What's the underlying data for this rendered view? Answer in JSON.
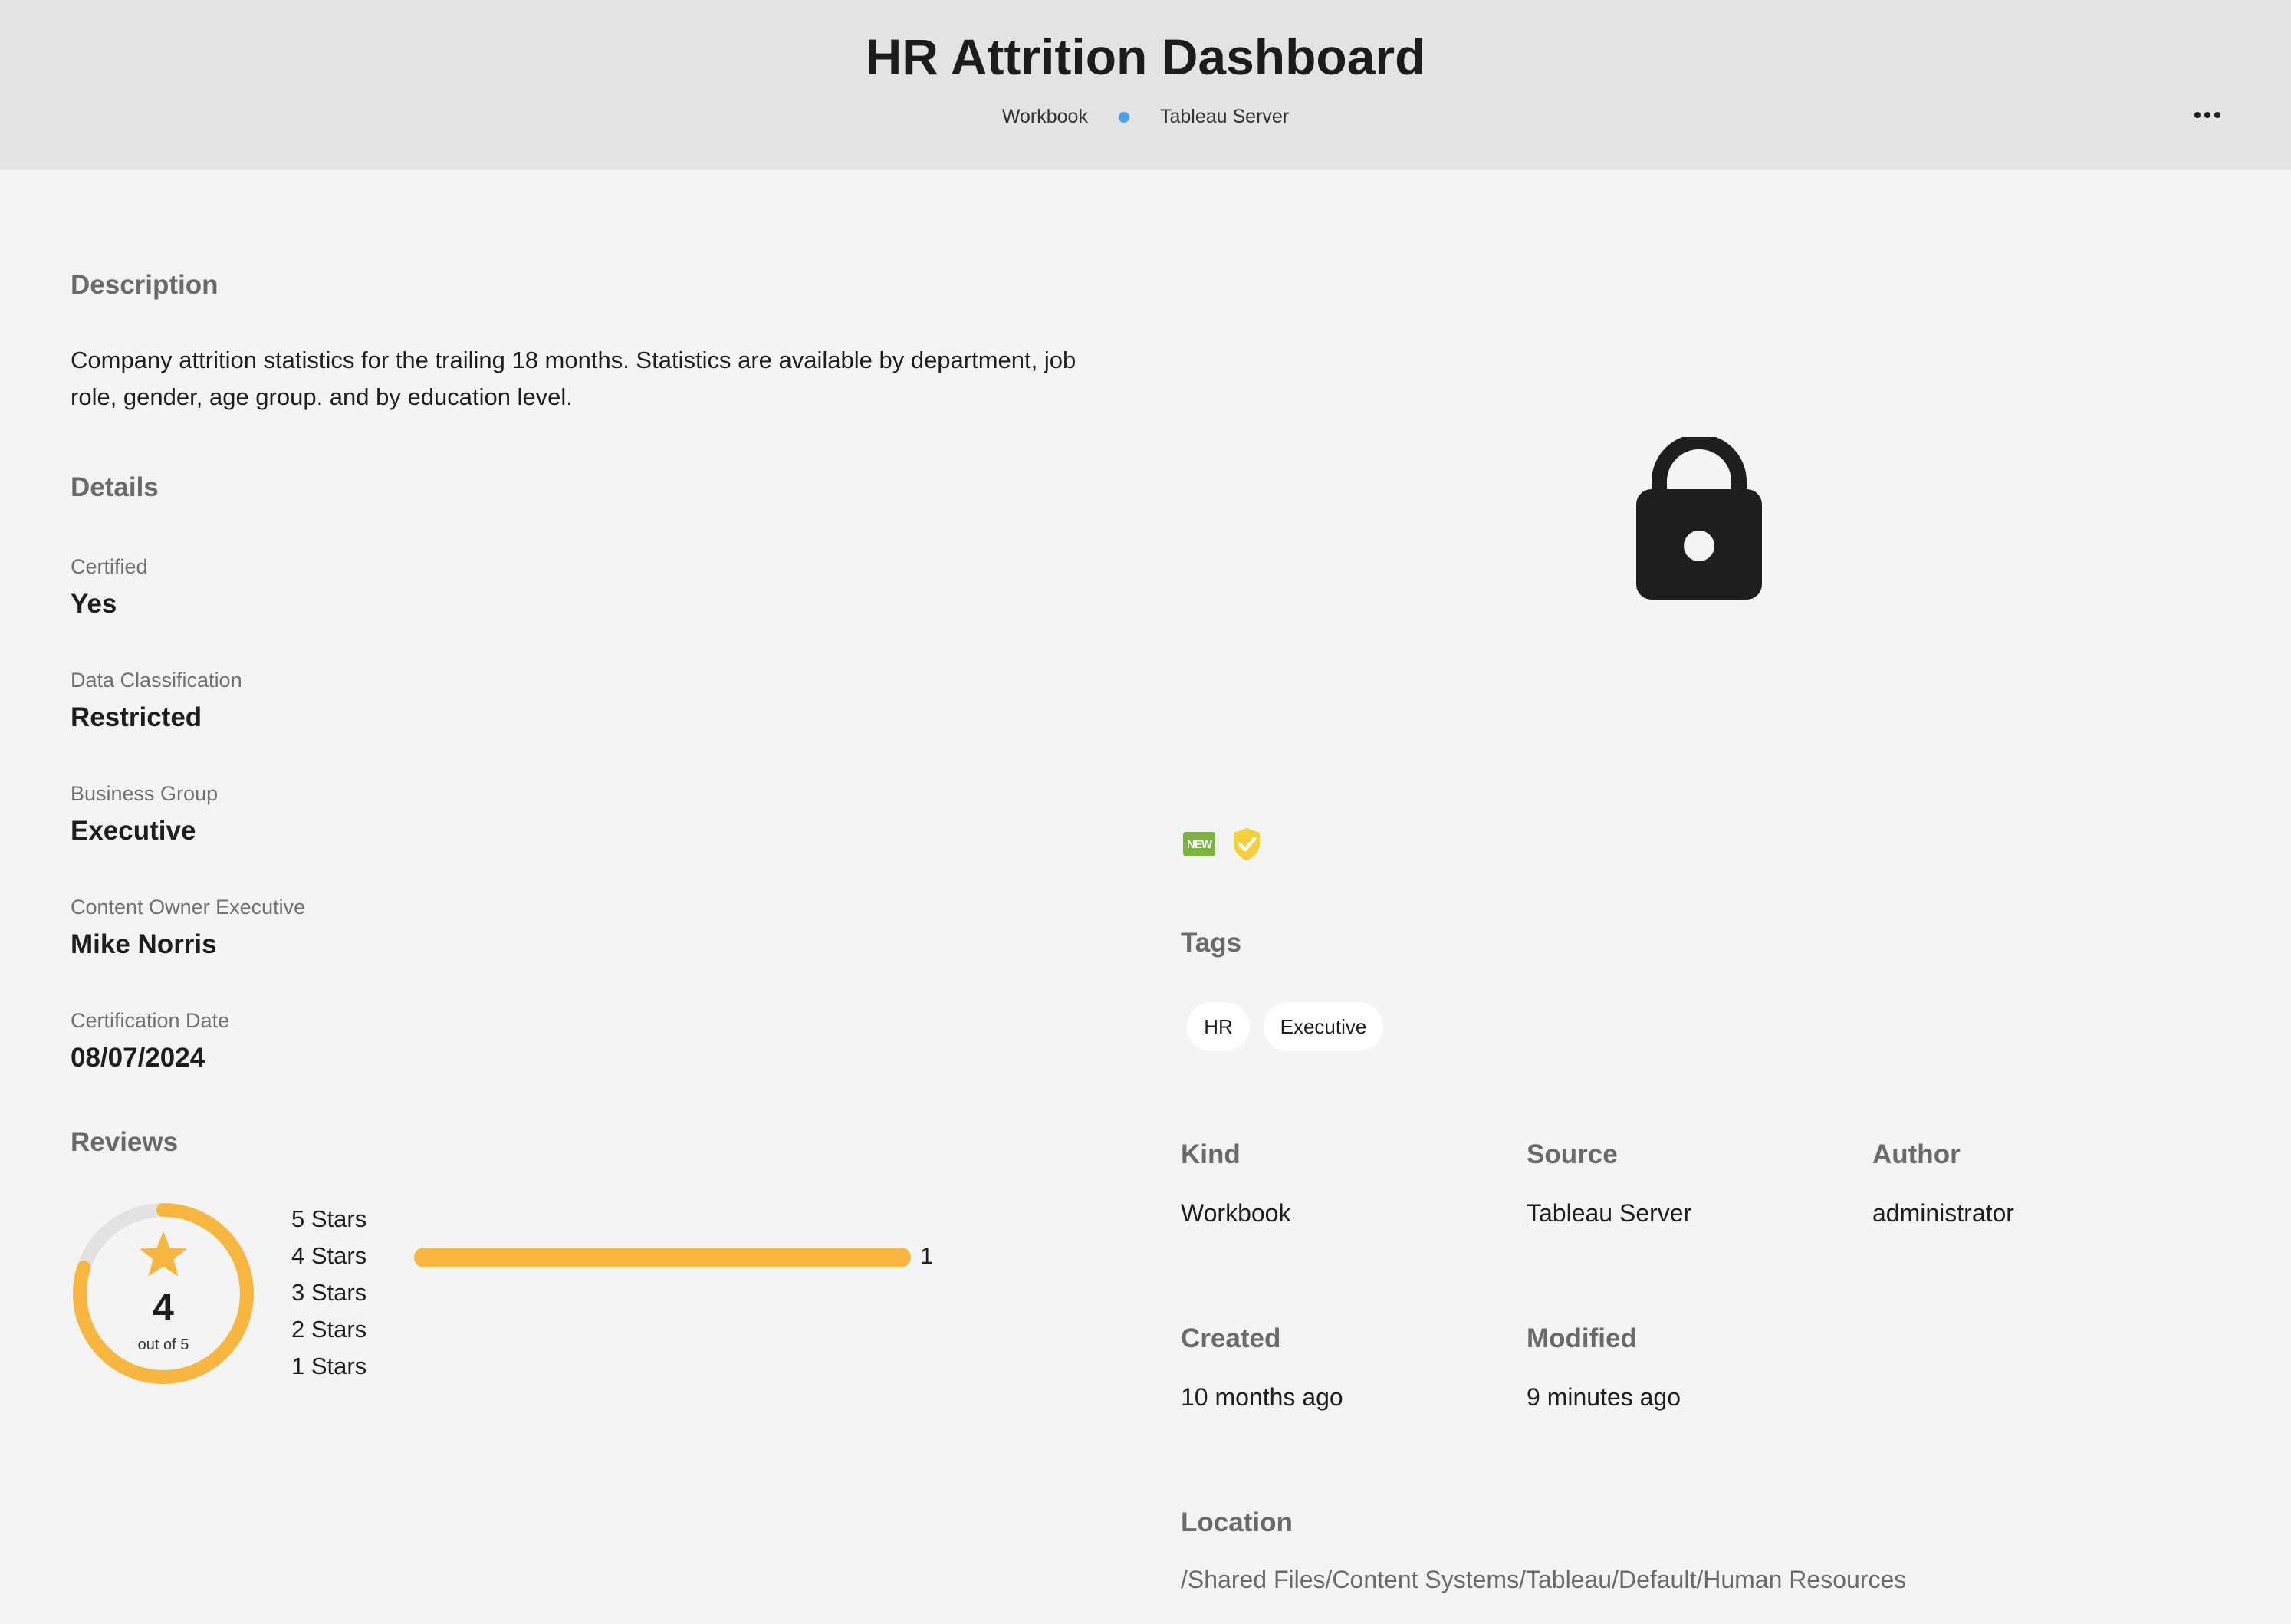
{
  "header": {
    "title": "HR Attrition Dashboard",
    "kind": "Workbook",
    "source": "Tableau Server"
  },
  "description": {
    "heading": "Description",
    "text": "Company attrition statistics for the trailing 18 months. Statistics are available by department, job role, gender, age group. and by education level."
  },
  "details": {
    "heading": "Details",
    "items": [
      {
        "label": "Certified",
        "value": "Yes"
      },
      {
        "label": "Data Classification",
        "value": "Restricted"
      },
      {
        "label": "Business Group",
        "value": "Executive"
      },
      {
        "label": "Content Owner Executive",
        "value": "Mike Norris"
      },
      {
        "label": "Certification Date",
        "value": "08/07/2024"
      }
    ]
  },
  "reviews": {
    "heading": "Reviews",
    "rating": "4",
    "rating_fraction": 0.8,
    "out_of": "out of 5",
    "rows": [
      {
        "label": "5 Stars",
        "count": 0
      },
      {
        "label": "4 Stars",
        "count": 1,
        "count_label": "1"
      },
      {
        "label": "3 Stars",
        "count": 0
      },
      {
        "label": "2 Stars",
        "count": 0
      },
      {
        "label": "1 Stars",
        "count": 0
      }
    ],
    "color": "#f6b640"
  },
  "badges": {
    "new_label": "NEW",
    "new_color": "#7cb342",
    "certified_color": "#f4d03f"
  },
  "tags": {
    "heading": "Tags",
    "items": [
      "HR",
      "Executive"
    ]
  },
  "meta": {
    "kind_label": "Kind",
    "kind_value": "Workbook",
    "source_label": "Source",
    "source_value": "Tableau Server",
    "author_label": "Author",
    "author_value": "administrator",
    "created_label": "Created",
    "created_value": "10 months ago",
    "modified_label": "Modified",
    "modified_value": "9 minutes ago",
    "location_label": "Location",
    "location_value": "/Shared Files/Content Systems/Tableau/Default/Human Resources"
  },
  "icons": {
    "more": "more-icon",
    "lock": "lock-icon",
    "star": "star-icon",
    "shield": "shield-check-icon"
  }
}
